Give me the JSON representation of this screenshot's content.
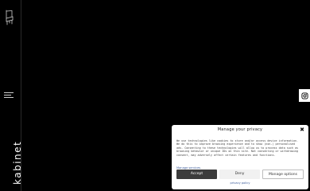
{
  "brand": {
    "name": "kabinet",
    "logo_icon": "chair-icon",
    "menu_icon": "hamburger-menu-icon"
  },
  "social": {
    "instagram_icon": "instagram-icon"
  },
  "consent": {
    "title": "Manage your privacy",
    "close_label": "✖",
    "body": "We use technologies like cookies to store and/or access device information. We do this to improve browsing experience and to show (non-) personalised ads. Consenting to these technologies will allow us to process data such as browsing behavior or unique IDs on this site. Not consenting or withdrawing consent, may adversely affect certain features and functions.",
    "manage_services": "Manage services",
    "accept_label": "Accept",
    "deny_label": "Deny",
    "options_label": "Manage options",
    "privacy_policy": "privacy policy"
  },
  "colors": {
    "background": "#000000",
    "dialog": "#ffffff",
    "accept_button": "#3c3c3c",
    "link": "#3a5a9a"
  }
}
